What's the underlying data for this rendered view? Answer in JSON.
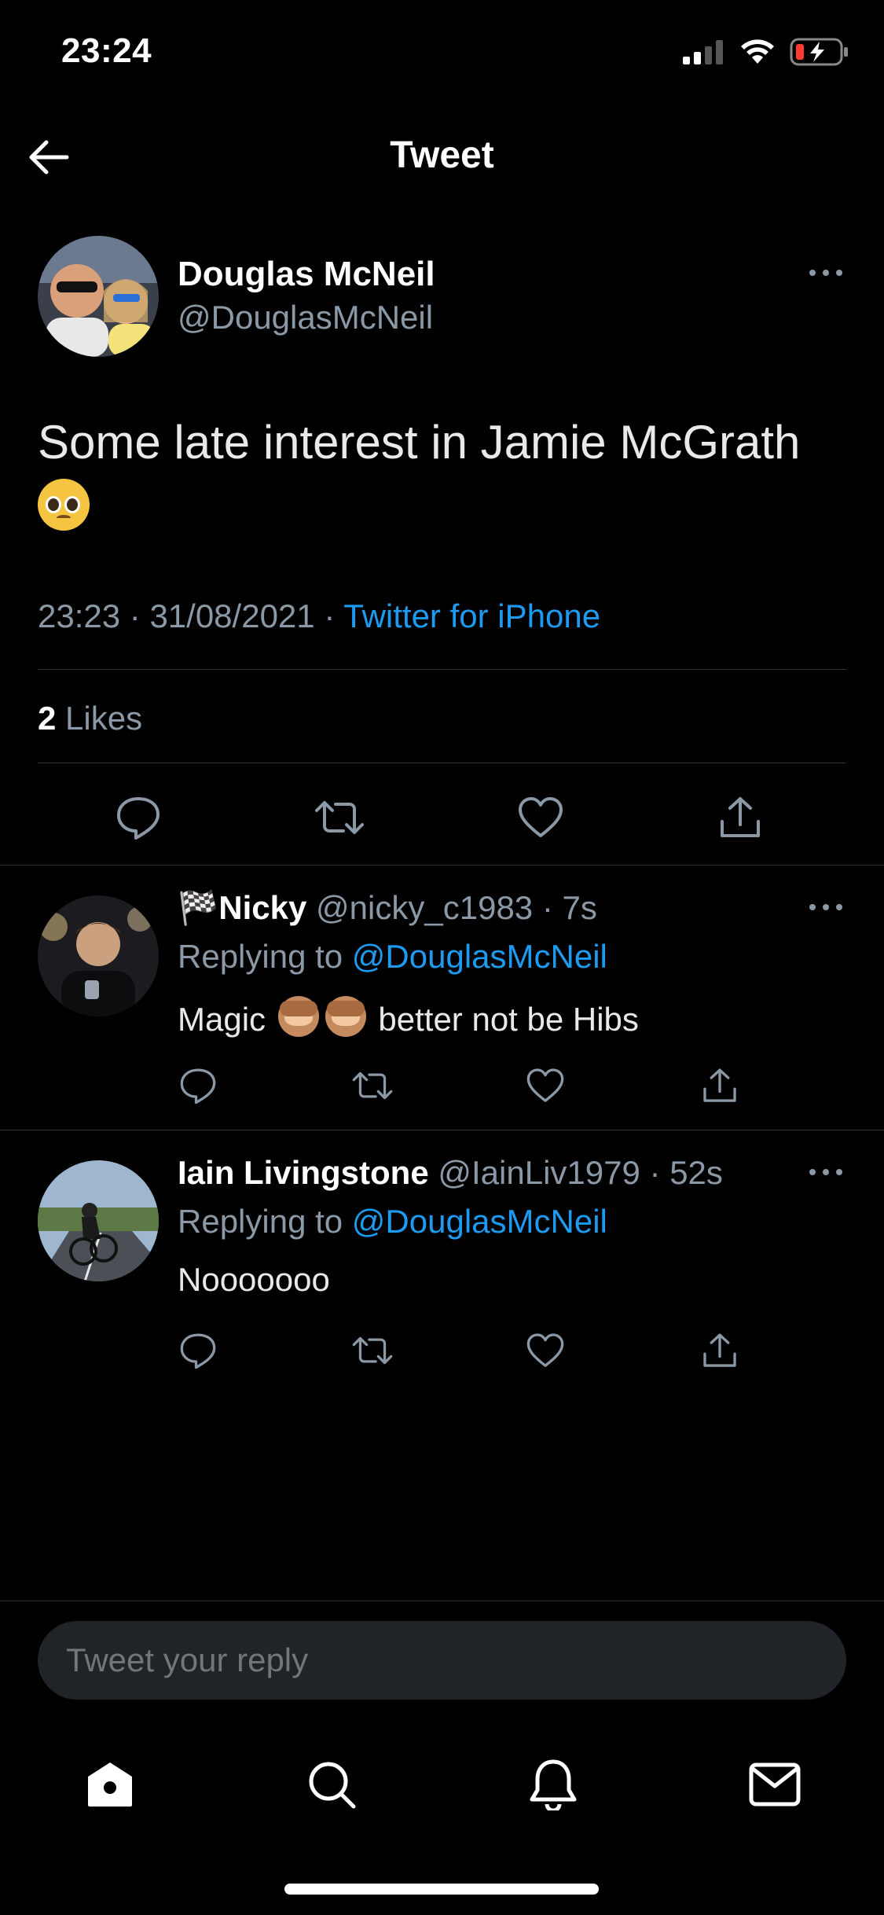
{
  "status_bar": {
    "time": "23:24"
  },
  "header": {
    "title": "Tweet"
  },
  "main_tweet": {
    "author_name": "Douglas McNeil",
    "author_handle": "@DouglasMcNeil",
    "text": "Some late interest in Jamie McGrath",
    "time": "23:23",
    "date": "31/08/2021",
    "source": "Twitter for iPhone",
    "likes_count": "2",
    "likes_label": "Likes"
  },
  "replies": [
    {
      "flag": "🏁",
      "name": "Nicky",
      "handle": "@nicky_c1983",
      "time": "7s",
      "replying_prefix": "Replying to",
      "replying_to": "@DouglasMcNeil",
      "text_before": "Magic",
      "text_after": "better not be Hibs"
    },
    {
      "name": "Iain Livingstone",
      "handle": "@IainLiv1979",
      "time": "52s",
      "replying_prefix": "Replying to",
      "replying_to": "@DouglasMcNeil",
      "text": "Nooooooo"
    }
  ],
  "composer": {
    "placeholder": "Tweet your reply"
  },
  "icons": {
    "back": "back-arrow-icon",
    "more": "more-icon",
    "reply": "reply-icon",
    "retweet": "retweet-icon",
    "like": "heart-icon",
    "share": "share-icon",
    "home": "home-icon",
    "search": "search-icon",
    "notifications": "bell-icon",
    "messages": "mail-icon"
  },
  "colors": {
    "background": "#000000",
    "accent": "#1d9bf0",
    "secondary_text": "#8b98a5",
    "divider": "#2f3336"
  }
}
